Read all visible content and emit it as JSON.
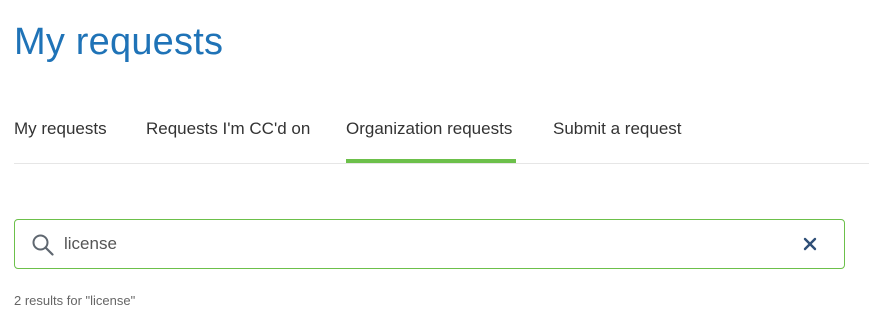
{
  "page": {
    "title": "My requests"
  },
  "tabs": [
    {
      "label": "My requests",
      "active": false
    },
    {
      "label": "Requests I'm CC'd on",
      "active": false
    },
    {
      "label": "Organization requests",
      "active": true
    },
    {
      "label": "Submit a request",
      "active": false
    }
  ],
  "search": {
    "value": "license",
    "icon": "search-icon",
    "clear_icon": "close-icon"
  },
  "results": {
    "summary": "2 results for \"license\""
  },
  "colors": {
    "title": "#1f73b7",
    "accent": "#6cc04a",
    "clear_icon": "#2f4f77"
  }
}
